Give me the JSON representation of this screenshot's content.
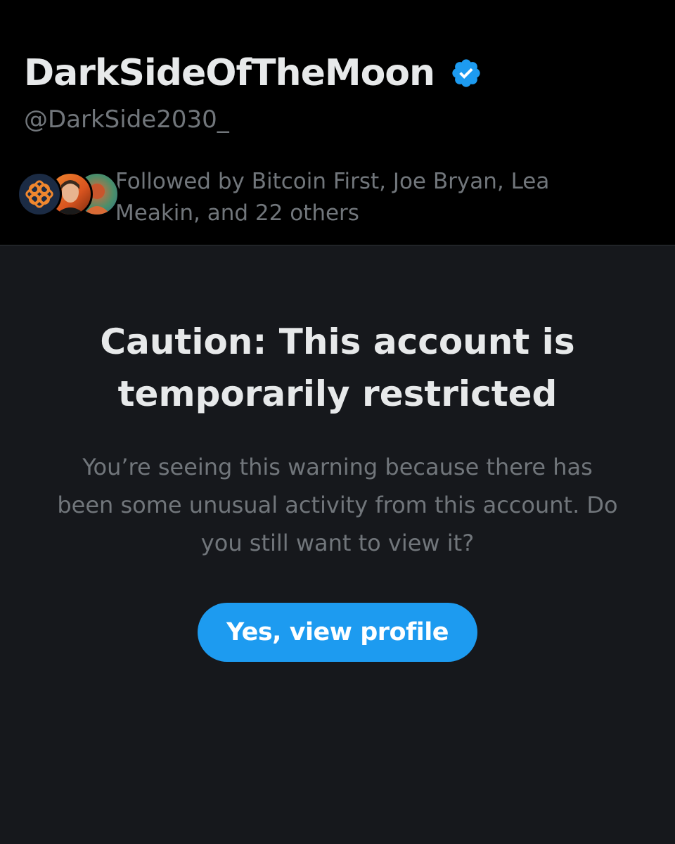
{
  "profile": {
    "display_name": "DarkSideOfTheMoon",
    "verified": true,
    "verified_icon": "verified-badge-icon",
    "handle": "@DarkSide2030_",
    "followed_by_text": "Followed by Bitcoin First, Joe Bryan, Lea Meakin, and 22 others",
    "follower_avatars": [
      "bitcoin-first-avatar",
      "joe-bryan-avatar",
      "lea-meakin-avatar"
    ]
  },
  "warning": {
    "title": "Caution: This account is temporarily restricted",
    "body": "You’re seeing this warning because there has been some unusual activity from this account. Do you still want to view it?",
    "button_label": "Yes, view profile"
  },
  "colors": {
    "background": "#000000",
    "panel_background": "#16181c",
    "primary_text": "#e7e9ea",
    "secondary_text": "#71767b",
    "accent_blue": "#1d9bf0"
  }
}
